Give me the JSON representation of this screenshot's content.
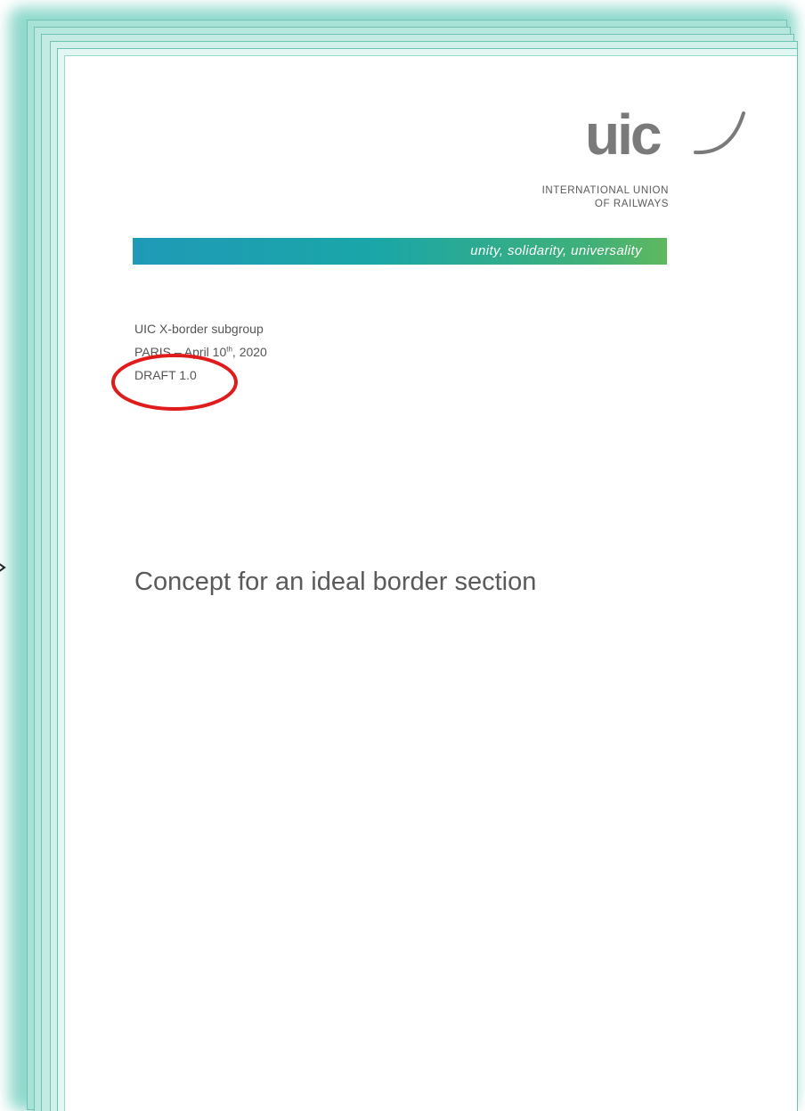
{
  "document": {
    "logo_text": "uic",
    "org_name_line1": "INTERNATIONAL UNION",
    "org_name_line2": "OF RAILWAYS",
    "slogan": "unity, solidarity, universality",
    "group": "UIC X-border subgroup",
    "location_date": {
      "city": "PARIS",
      "separator": " – ",
      "month_day": "April 10",
      "day_suffix": "th",
      "year_text": ", 2020"
    },
    "version": "DRAFT 1.0",
    "title": "Concept for an ideal border section"
  },
  "annotation": {
    "highlight_target": "version",
    "highlight_color": "#e01b1b"
  },
  "colors": {
    "frame_teal": "#7dd3c4",
    "slogan_gradient_start": "#1f9ab7",
    "slogan_gradient_end": "#5fb85f",
    "logo_gray": "#7a7a7a",
    "text_gray": "#555555"
  }
}
